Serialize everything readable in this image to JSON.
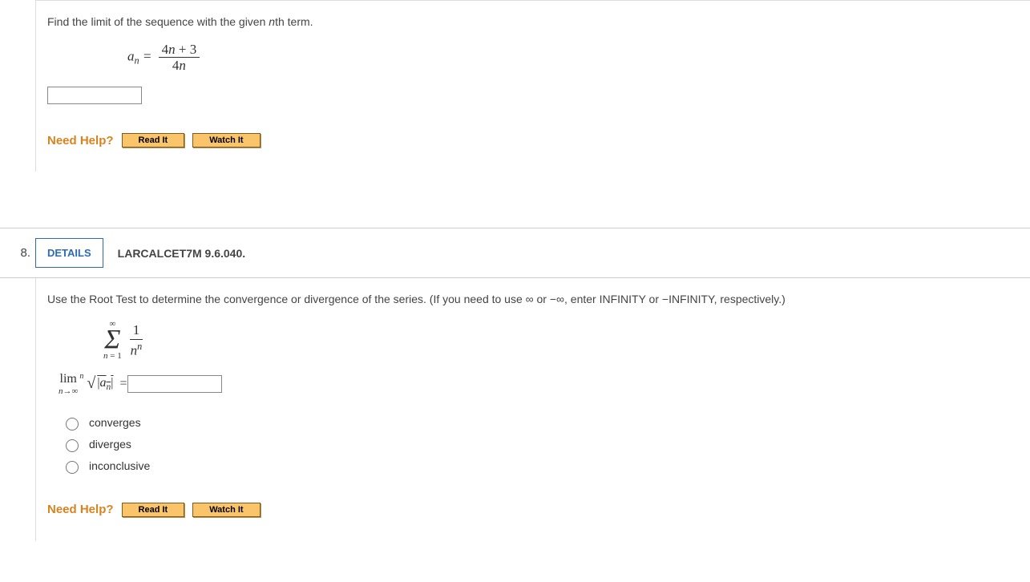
{
  "q7": {
    "prompt_pre": "Find the limit of the sequence with the given ",
    "prompt_mid_italic": "n",
    "prompt_post": "th term.",
    "formula": {
      "lhs_a": "a",
      "lhs_sub": "n",
      "eq": " = ",
      "num_pre": "4",
      "num_var": "n",
      "num_post": " + 3",
      "den_pre": "4",
      "den_var": "n"
    },
    "need_help": "Need Help?",
    "read_it": "Read It",
    "watch_it": "Watch It"
  },
  "q8": {
    "number": "8.",
    "details": "DETAILS",
    "ref": "LARCALCET7M 9.6.040.",
    "prompt": "Use the Root Test to determine the convergence or divergence of the series. (If you need to use ∞ or −∞, enter INFINITY or −INFINITY, respectively.)",
    "series": {
      "top": "∞",
      "bottom_lhs": "n",
      "bottom_rhs": " = 1",
      "frac_num": "1",
      "frac_den_base": "n",
      "frac_den_exp": "n"
    },
    "limit": {
      "lim": "lim",
      "sub_lhs": "n",
      "sub_arrow": "→∞",
      "root_idx": "n",
      "root_content_pre": "|",
      "root_a": "a",
      "root_sub": "n",
      "root_content_post": "|",
      "eq": " = "
    },
    "options": {
      "o1": "converges",
      "o2": "diverges",
      "o3": "inconclusive"
    },
    "need_help": "Need Help?",
    "read_it": "Read It",
    "watch_it": "Watch It"
  }
}
